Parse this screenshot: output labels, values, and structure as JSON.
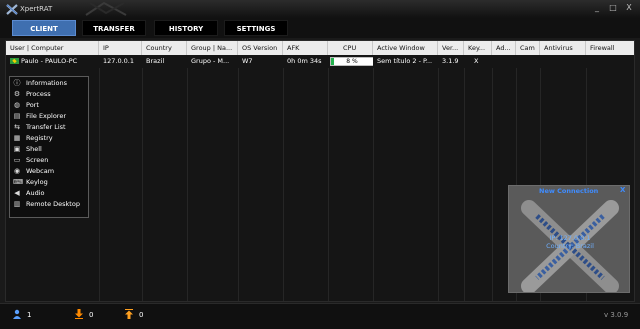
{
  "window": {
    "title": "XpertRAT",
    "controls": [
      "_",
      "□",
      "X"
    ]
  },
  "tabs": [
    {
      "label": "CLIENT",
      "active": true
    },
    {
      "label": "TRANSFER",
      "active": false
    },
    {
      "label": "HISTORY",
      "active": false
    },
    {
      "label": "SETTINGS",
      "active": false
    }
  ],
  "grid": {
    "columns": [
      "User | Computer",
      "IP",
      "Country",
      "Group | Na...",
      "OS Version",
      "AFK",
      "CPU",
      "Active Window",
      "Ver...",
      "Key...",
      "Ad...",
      "Cam",
      "Antivirus",
      "Firewall"
    ],
    "rows": [
      {
        "user": "Paulo - PAULO-PC",
        "ip": "127.0.0.1",
        "country": "Brazil",
        "group": "Grupo - M...",
        "os": "W7",
        "afk": "0h 0m 34s",
        "cpu_text": "8 %",
        "cpu_percent": 8,
        "active_window": "Sem título 2 - P...",
        "version": "3.1.9",
        "keylogger": "X",
        "admin": "",
        "cam": "",
        "antivirus": "",
        "firewall": ""
      }
    ]
  },
  "context_menu": {
    "items": [
      {
        "label": "Informations",
        "icon": "info-icon"
      },
      {
        "label": "Process",
        "icon": "gear-icon"
      },
      {
        "label": "Port",
        "icon": "globe-icon"
      },
      {
        "label": "File Explorer",
        "icon": "folder-icon"
      },
      {
        "label": "Transfer List",
        "icon": "transfer-icon"
      },
      {
        "label": "Registry",
        "icon": "registry-icon"
      },
      {
        "label": "Shell",
        "icon": "terminal-icon"
      },
      {
        "label": "Screen",
        "icon": "monitor-icon"
      },
      {
        "label": "Webcam",
        "icon": "webcam-icon"
      },
      {
        "label": "Keylog",
        "icon": "keyboard-icon"
      },
      {
        "label": "Audio",
        "icon": "speaker-icon"
      },
      {
        "label": "Remote Desktop",
        "icon": "remote-desktop-icon"
      }
    ]
  },
  "notification": {
    "title": "New Connection",
    "close_label": "X",
    "ip_line": "IP: 127.0.0.1",
    "country_line": "Country: Brazil"
  },
  "status": {
    "users_count": "1",
    "downloads_count": "0",
    "uploads_count": "0",
    "version": "v 3.0.9"
  },
  "colors": {
    "active_tab": "#3f6fb0",
    "cpu_fill": "#22b14c",
    "notify_text": "#3f8cff",
    "download_icon": "#ff8a00",
    "upload_icon": "#ffa020",
    "user_icon": "#5aa0ff"
  }
}
